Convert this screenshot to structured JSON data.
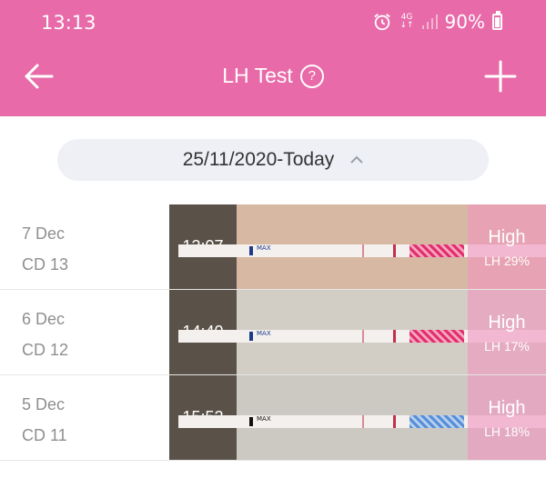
{
  "status_bar": {
    "time": "13:13",
    "network": "4G",
    "battery": "90%"
  },
  "header": {
    "title": "LH Test",
    "help_icon": "?"
  },
  "range": {
    "label": "25/11/2020-Today"
  },
  "rows": [
    {
      "date": "7 Dec",
      "cycle_day": "CD 13",
      "time": "13:07",
      "level": "High",
      "lh": "LH 29%",
      "strip_text": "MAX",
      "bg": "#d7b8a3"
    },
    {
      "date": "6 Dec",
      "cycle_day": "CD 12",
      "time": "14:40",
      "level": "High",
      "lh": "LH 17%",
      "strip_text": "MAX",
      "bg": "#d2cdc5"
    },
    {
      "date": "5 Dec",
      "cycle_day": "CD 11",
      "time": "15:52",
      "level": "High",
      "lh": "LH 18%",
      "strip_text": "MAX",
      "bg": "#ccc8c2"
    }
  ],
  "colors": {
    "brand": "#e86aa8",
    "pill_bg": "#eef0f6"
  }
}
